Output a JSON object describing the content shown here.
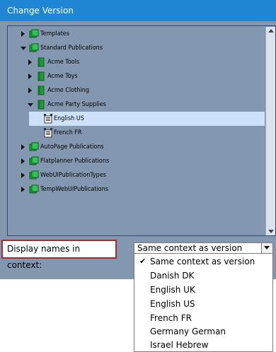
{
  "dialog": {
    "title": "Change Version"
  },
  "tree": {
    "rows": [
      {
        "label": "Templates"
      },
      {
        "label": "Standard Publications"
      },
      {
        "label": "Acme Tools"
      },
      {
        "label": "Acme Toys"
      },
      {
        "label": "Acme Clothing"
      },
      {
        "label": "Acme Party Supplies"
      },
      {
        "label": "English US"
      },
      {
        "label": "French FR"
      },
      {
        "label": "AutoPage Publications"
      },
      {
        "label": "Flatplanner Publications"
      },
      {
        "label": "WebUIPublicationTypes"
      },
      {
        "label": "TempWebUIPublications"
      }
    ]
  },
  "context": {
    "label": "Display names in context:",
    "selected": "Same context as version",
    "check_mark": "✔",
    "options": [
      "Same context as version",
      "Danish DK",
      "English UK",
      "English US",
      "French FR",
      "Germany German",
      "Israel Hebrew"
    ]
  },
  "colors": {
    "title_bar": "#1f86d6",
    "panel": "#8497b0",
    "selection": "#cde2fa",
    "highlight_border": "#b32626",
    "folder_green": "#1e9c3a"
  },
  "icons": {
    "folder": "green-folder-icon",
    "publication": "green-book-icon",
    "version": "version-document-icon"
  }
}
